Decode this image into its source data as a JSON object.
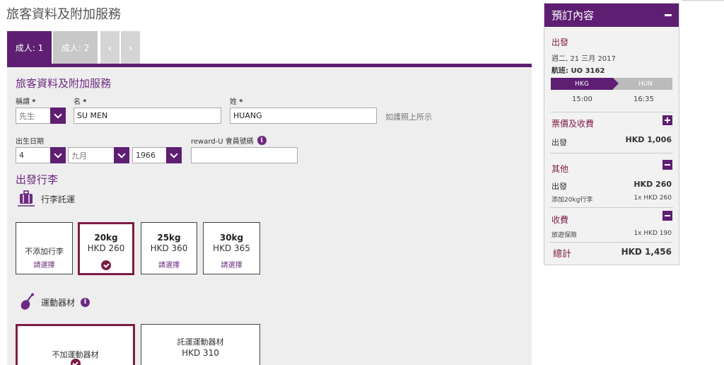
{
  "page": {
    "title": "旅客資料及附加服務"
  },
  "tabs": {
    "active": "成人: 1",
    "inactive": "成人: 2",
    "prev": "‹",
    "next": "›"
  },
  "form": {
    "section_title": "旅客資料及附加服務",
    "title_label": "稱謂",
    "required": "*",
    "title_value": "先生",
    "first_name_label": "名",
    "first_name_value": "SU MEN",
    "last_name_label": "姓",
    "last_name_value": "HUANG",
    "passport_hint": "如護照上所示",
    "dob_label": "出生日期",
    "dob_day": "4",
    "dob_month": "九月",
    "dob_year": "1966",
    "reward_label": "reward-U 會員號碼",
    "reward_value": ""
  },
  "baggage": {
    "section_title": "出發行李",
    "checked_label": "行李託運",
    "options": [
      {
        "single": "不添加行李",
        "choose": "請選擇"
      },
      {
        "weight": "20kg",
        "price": "HKD 260"
      },
      {
        "weight": "25kg",
        "price": "HKD 360",
        "choose": "請選擇"
      },
      {
        "weight": "30kg",
        "price": "HKD 365",
        "choose": "請選擇"
      }
    ]
  },
  "sports": {
    "label": "運動器材",
    "options": [
      {
        "single": "不加運動器材"
      },
      {
        "title": "託運運動器材",
        "price": "HKD 310"
      }
    ]
  },
  "sidebar": {
    "title": "預訂內容",
    "departure_label": "出發",
    "date": "週二, 21 三月 2017",
    "flight": "航班: UO 3162",
    "route_from": "HKG",
    "route_to": "HUN",
    "dep_time": "15:00",
    "arr_time": "16:35",
    "fares_title": "票價及收費",
    "fares_item": "出發",
    "fares_amount": "HKD 1,006",
    "other_title": "其他",
    "other_item": "出發",
    "other_amount": "HKD 260",
    "other_sub": "添加20kg行李",
    "other_sub_amount": "1x HKD 260",
    "fees_title": "收費",
    "fees_sub": "旅遊保險",
    "fees_sub_amount": "1x HKD 190",
    "total_label": "總計",
    "total_amount": "HKD 1,456"
  }
}
